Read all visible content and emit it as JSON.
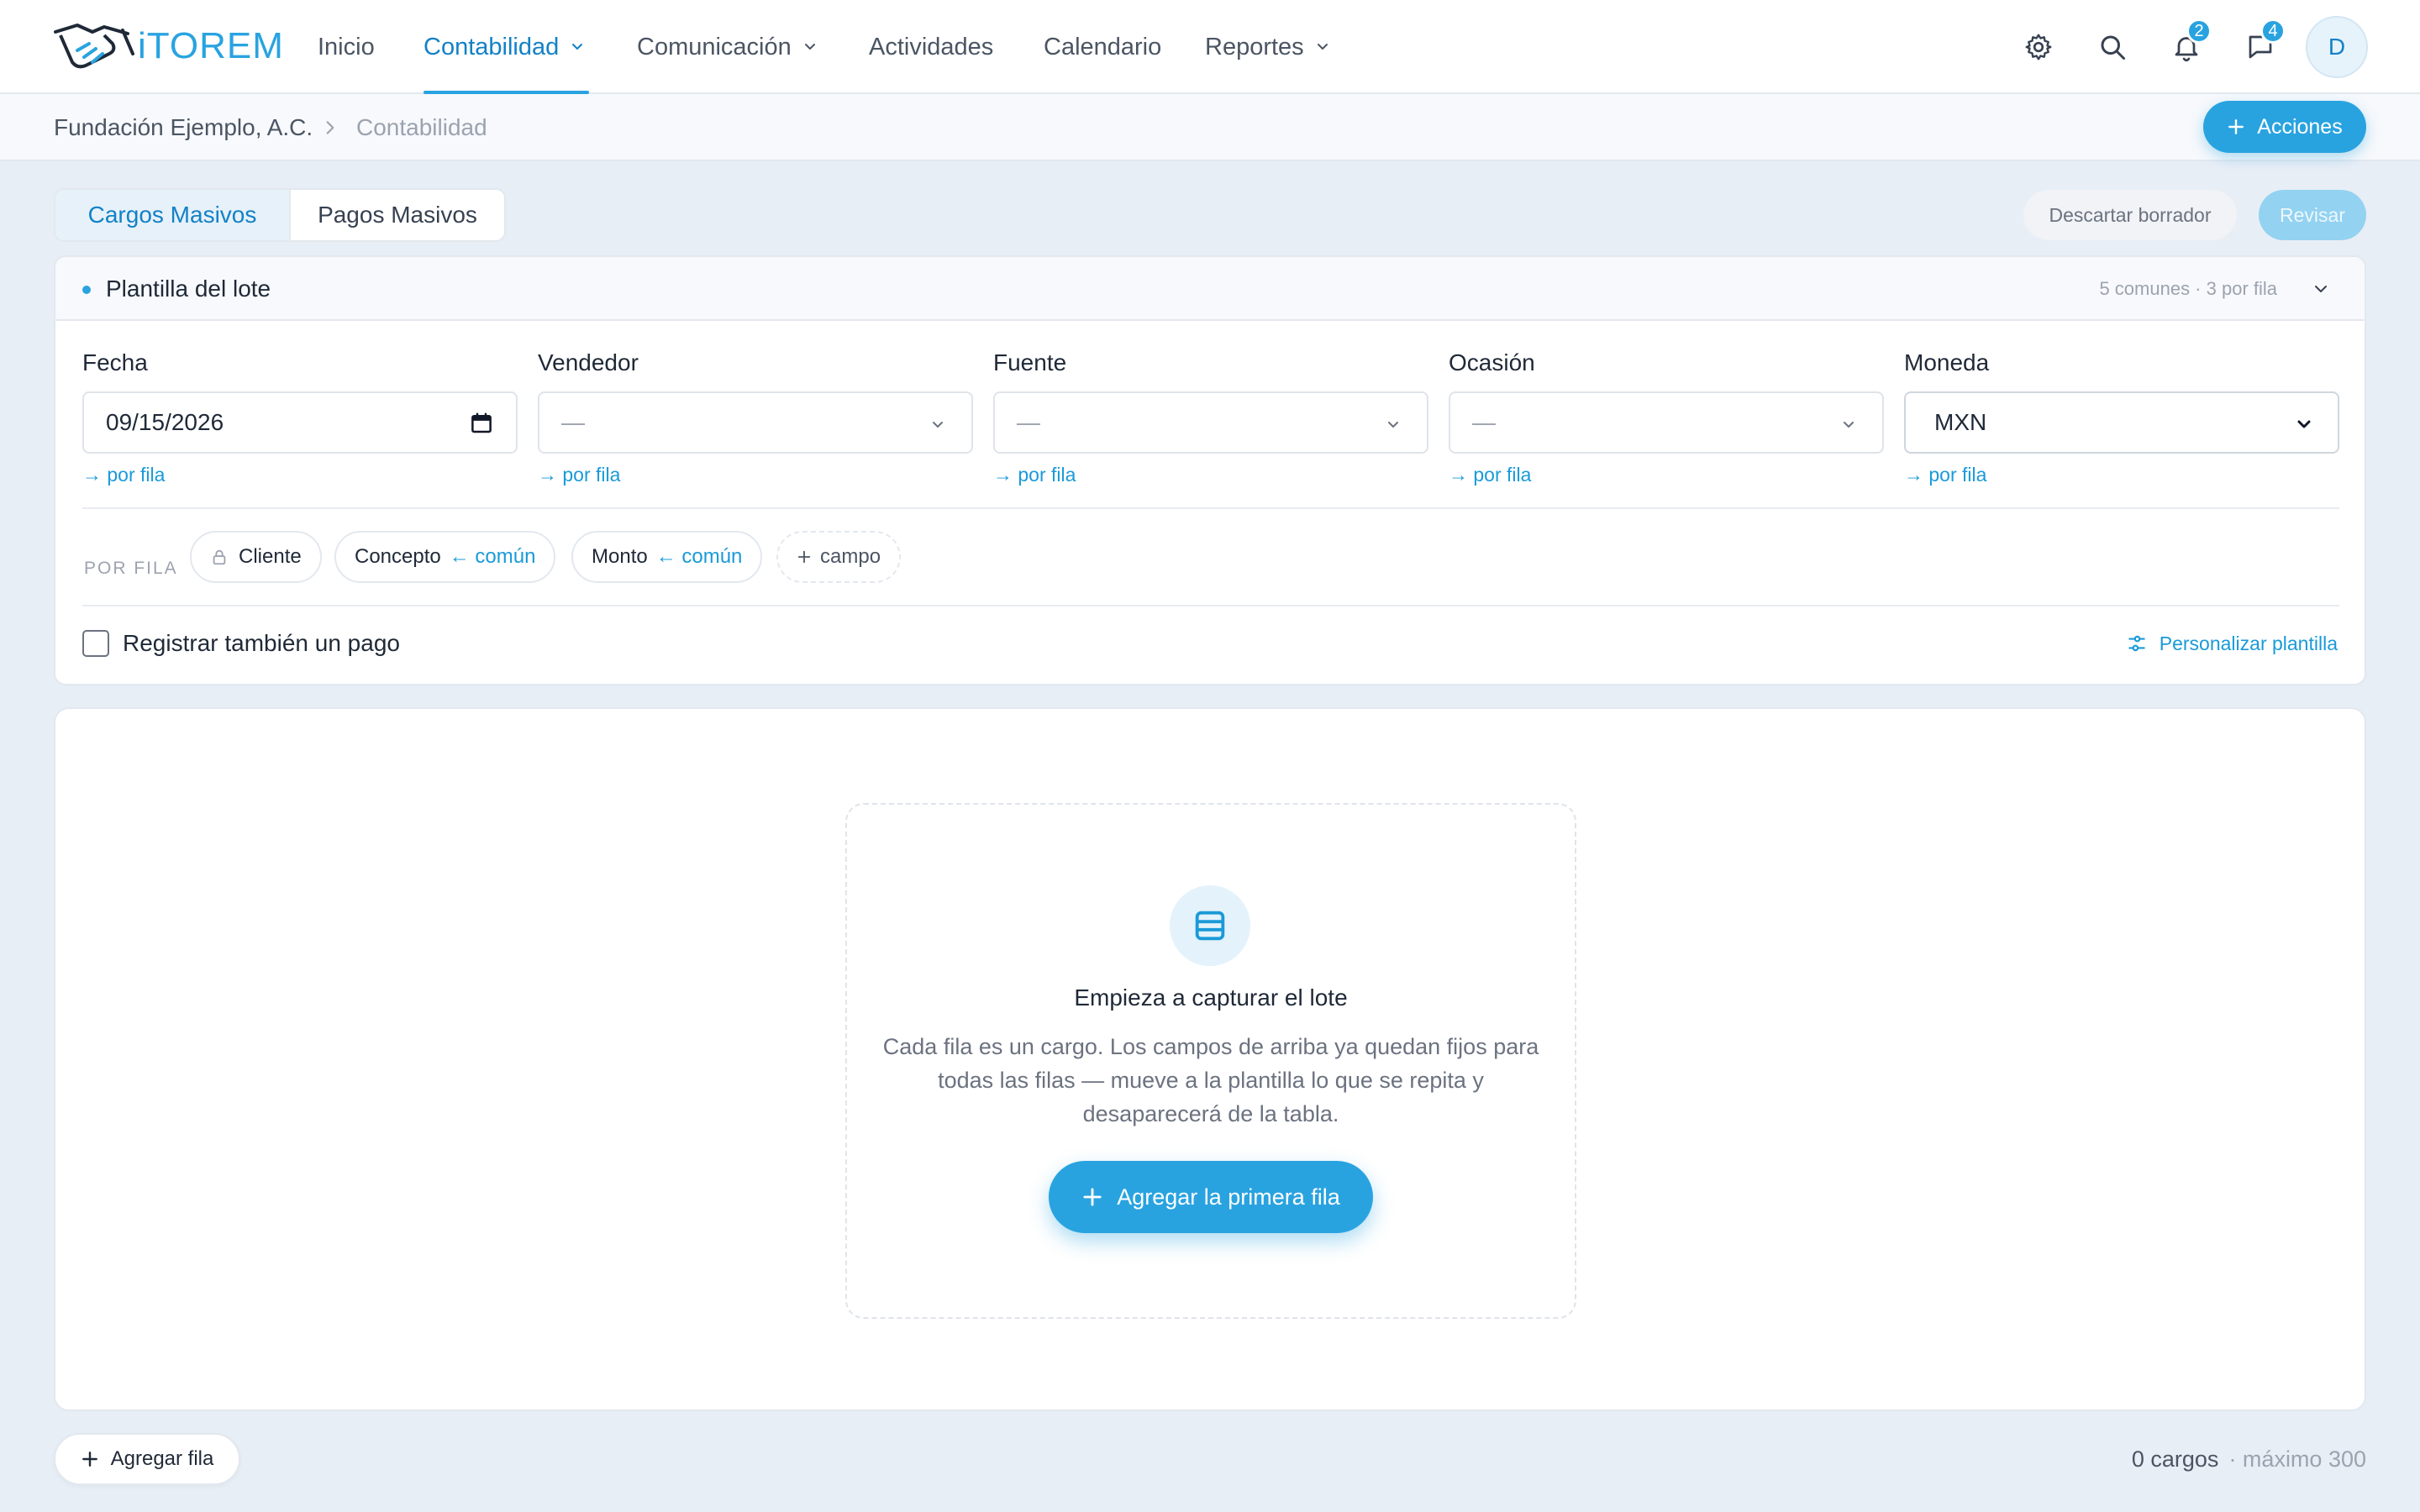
{
  "app": {
    "logo_text": "iTOREM",
    "brand_color": "#29a3e0",
    "logo_icon": "handshake-icon"
  },
  "nav": {
    "items": [
      {
        "label": "Inicio",
        "has_dropdown": false,
        "active": false
      },
      {
        "label": "Contabilidad",
        "has_dropdown": true,
        "active": true
      },
      {
        "label": "Comunicación",
        "has_dropdown": true,
        "active": false
      },
      {
        "label": "Actividades",
        "has_dropdown": false,
        "active": false
      },
      {
        "label": "Calendario",
        "has_dropdown": false,
        "active": false
      },
      {
        "label": "Reportes",
        "has_dropdown": true,
        "active": false
      }
    ],
    "icons": [
      "gear-icon",
      "search-icon",
      "bell-icon",
      "chat-icon"
    ],
    "notifications_count": "2",
    "messages_count": "4",
    "avatar_initial": "D"
  },
  "breadcrumb": {
    "org": "Fundación Ejemplo, A.C.",
    "current": "Contabilidad",
    "actions_label": "Acciones"
  },
  "tabs": [
    {
      "label": "Cargos Masivos",
      "active": true
    },
    {
      "label": "Pagos Masivos",
      "active": false
    }
  ],
  "toolbar": {
    "discard_label": "Descartar borrador",
    "review_label": "Revisar"
  },
  "template": {
    "title": "Plantilla del lote",
    "meta": "5 comunes · 3 por fila",
    "fields": [
      {
        "label": "Fecha",
        "value": "09/15/2026",
        "link": "→ por fila"
      },
      {
        "label": "Vendedor",
        "value": "—",
        "link": "→ por fila"
      },
      {
        "label": "Fuente",
        "value": "—",
        "link": "→ por fila"
      },
      {
        "label": "Ocasión",
        "value": "—",
        "link": "→ por fila"
      },
      {
        "label": "Moneda",
        "value": "MXN",
        "link": "→ por fila"
      }
    ],
    "per_row_label": "POR FILA",
    "per_row_chips": {
      "cliente": "Cliente",
      "concepto": "Concepto",
      "concepto_tag": "← común",
      "monto": "Monto",
      "monto_tag": "← común",
      "add_field": "campo"
    },
    "register_payment_label": "Registrar también un pago",
    "register_payment_checked": false,
    "customize_label": "Personalizar plantilla"
  },
  "empty_state": {
    "title": "Empieza a capturar el lote",
    "description": "Cada fila es un cargo. Los campos de arriba ya quedan fijos para todas las filas — mueve a la plantilla lo que se repita y desaparecerá de la tabla.",
    "button_label": "Agregar la primera fila"
  },
  "footer": {
    "add_row_label": "Agregar fila",
    "count_label": "0 cargos",
    "max_label": "· máximo 300"
  }
}
